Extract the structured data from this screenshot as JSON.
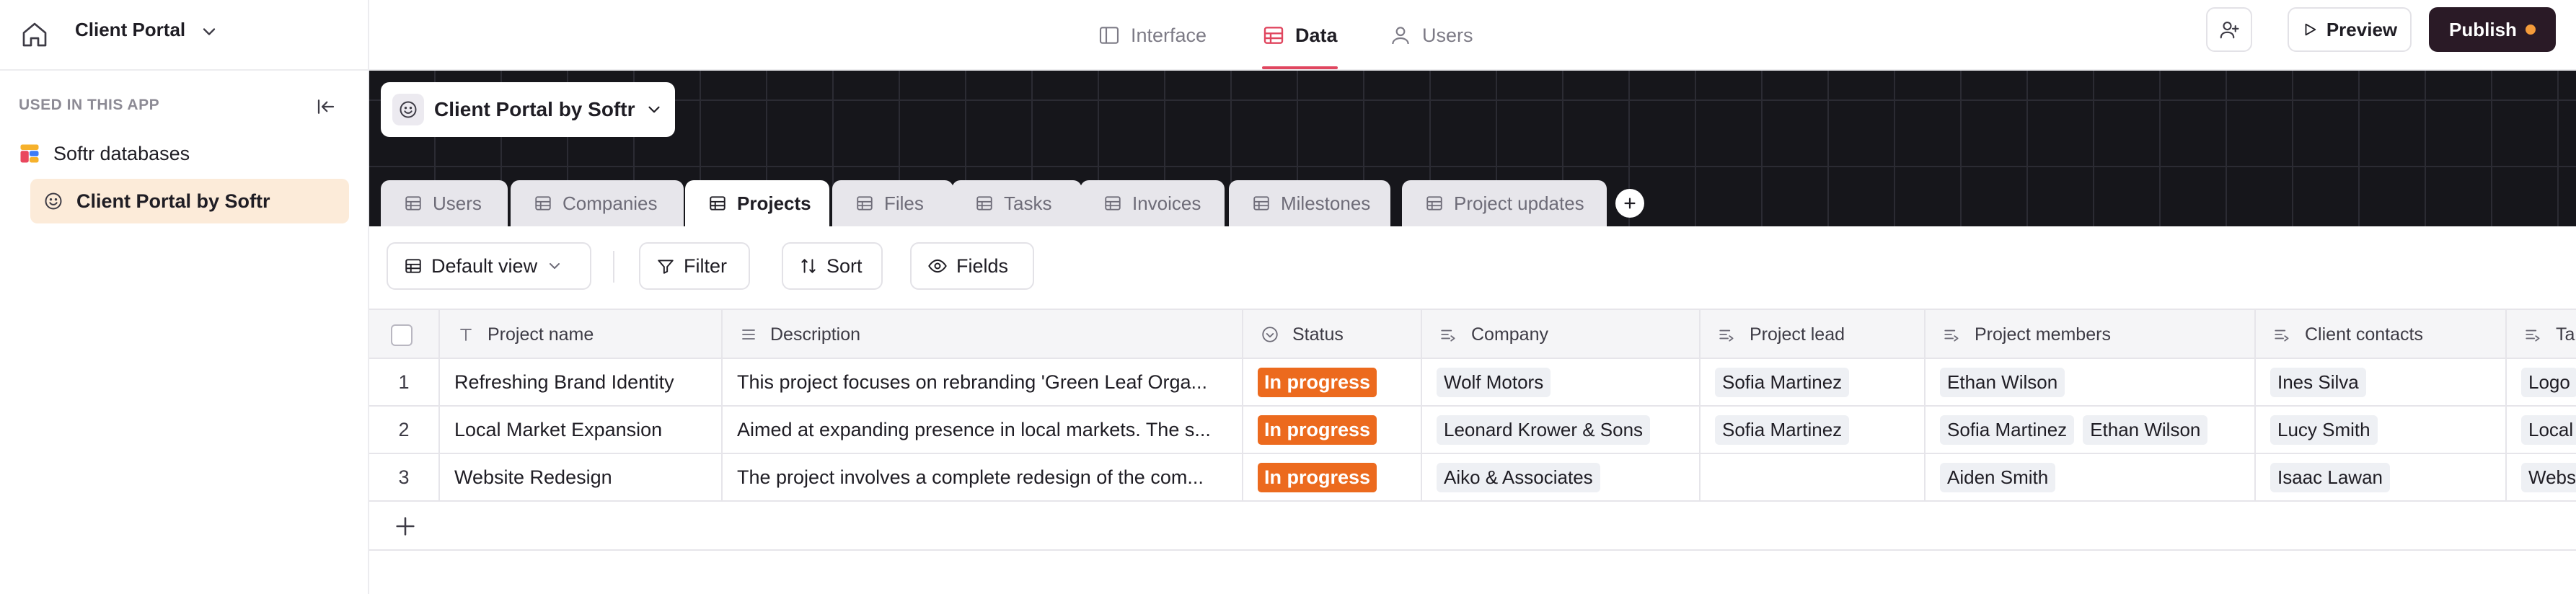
{
  "app": {
    "name": "Client Portal"
  },
  "nav": {
    "interface": "Interface",
    "data": "Data",
    "users": "Users"
  },
  "actions": {
    "preview": "Preview",
    "publish": "Publish"
  },
  "sidebar": {
    "heading": "USED IN THIS APP",
    "items": [
      {
        "label": "Softr databases"
      },
      {
        "label": "Client Portal by Softr"
      }
    ]
  },
  "base": {
    "name": "Client Portal by Softr"
  },
  "tables": [
    "Users",
    "Companies",
    "Projects",
    "Files",
    "Tasks",
    "Invoices",
    "Milestones",
    "Project updates"
  ],
  "active_table": "Projects",
  "toolbar": {
    "view": "Default view",
    "filter": "Filter",
    "sort": "Sort",
    "fields": "Fields"
  },
  "columns": [
    "Project name",
    "Description",
    "Status",
    "Company",
    "Project lead",
    "Project members",
    "Client contacts",
    "Ta"
  ],
  "rows": [
    {
      "num": "1",
      "name": "Refreshing Brand Identity",
      "description": "This project focuses on rebranding 'Green Leaf Orga...",
      "status": "In progress",
      "company": "Wolf Motors",
      "lead": "Sofia Martinez",
      "members": [
        "Ethan Wilson"
      ],
      "contacts": "Ines Silva",
      "tag": "Logo"
    },
    {
      "num": "2",
      "name": "Local Market Expansion",
      "description": "Aimed at expanding presence in local markets. The s...",
      "status": "In progress",
      "company": "Leonard Krower & Sons",
      "lead": "Sofia Martinez",
      "members": [
        "Sofia Martinez",
        "Ethan Wilson"
      ],
      "contacts": "Lucy Smith",
      "tag": "Local"
    },
    {
      "num": "3",
      "name": "Website Redesign",
      "description": "The project involves a complete redesign of the com...",
      "status": "In progress",
      "company": "Aiko & Associates",
      "lead": "",
      "members": [
        "Aiden Smith"
      ],
      "contacts": "Isaac Lawan",
      "tag": "Webs"
    }
  ],
  "colors": {
    "accent": "#e0465f",
    "status_in_progress": "#ec6a1e",
    "publish_bg": "#2a1a26",
    "publish_dot": "#f49b3a",
    "active_sidebar": "#fcebd9"
  }
}
